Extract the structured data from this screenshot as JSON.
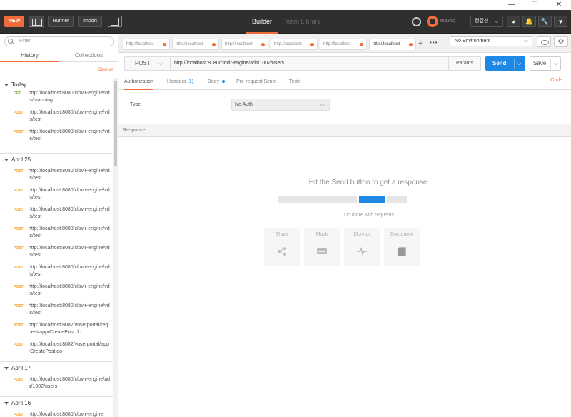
{
  "window": {
    "minimize": "—",
    "maximize": "☐",
    "close": "✕"
  },
  "header": {
    "new_label": "NEW",
    "runner_label": "Runner",
    "import_label": "Import",
    "modes": [
      "Builder",
      "Team Library"
    ],
    "sync_status": "IN SYNC",
    "user_name": "정길성"
  },
  "sidebar": {
    "search_placeholder": "Filter",
    "tabs": [
      "History",
      "Collections"
    ],
    "clear_all": "Clear all",
    "groups": [
      {
        "title": "Today",
        "items": [
          {
            "method": "GET",
            "url": "http://localhost:8080/clovir-engine/vdis/mapping"
          },
          {
            "method": "POST",
            "url": "http://localhost:8080/clovir-engine/vdis/test"
          },
          {
            "method": "POST",
            "url": "http://localhost:8080/clovir-engine/vdis/test"
          }
        ]
      },
      {
        "title": "April 25",
        "items": [
          {
            "method": "POST",
            "url": "http://localhost:8080/clovir-engine/vdis/test"
          },
          {
            "method": "POST",
            "url": "http://localhost:8080/clovir-engine/vdis/test"
          },
          {
            "method": "POST",
            "url": "http://localhost:8080/clovir-engine/vdis/test"
          },
          {
            "method": "POST",
            "url": "http://localhost:8080/clovir-engine/vdis/test"
          },
          {
            "method": "POST",
            "url": "http://localhost:8080/clovir-engine/vdis/test"
          },
          {
            "method": "POST",
            "url": "http://localhost:8080/clovir-engine/vdis/test"
          },
          {
            "method": "POST",
            "url": "http://localhost:8080/clovir-engine/vdis/test"
          },
          {
            "method": "POST",
            "url": "http://localhost:8080/clovir-engine/vdis/test"
          },
          {
            "method": "POST",
            "url": "http://localhost:8082/vuserportal/request/apprCreatePost.do"
          },
          {
            "method": "POST",
            "url": "http://localhost:8082/vuserportal/apprCreatePost.do"
          }
        ]
      },
      {
        "title": "April 17",
        "items": [
          {
            "method": "POST",
            "url": "http://localhost:8080/clovir-engine/ads/1002/users"
          }
        ]
      },
      {
        "title": "April 16",
        "items": [
          {
            "method": "POST",
            "url": "http://localhost:8080/clovir-engine"
          }
        ]
      }
    ]
  },
  "request_tabs": [
    {
      "label": "http://localhost"
    },
    {
      "label": "http://localhost"
    },
    {
      "label": "http://localhost"
    },
    {
      "label": "http://localhost"
    },
    {
      "label": "http://localhost"
    },
    {
      "label": "http://localhost"
    }
  ],
  "request_tab_add": "+",
  "request_tab_more": "•••",
  "environment": {
    "selected": "No Environment"
  },
  "request": {
    "method": "POST",
    "url": "http://localhost:8080/clovir-engine/ads/1002/users",
    "params_label": "Params",
    "send_label": "Send",
    "save_label": "Save"
  },
  "sub_tabs": {
    "authorization": "Authorization",
    "headers": "Headers",
    "headers_count": "(1)",
    "body": "Body",
    "pre_request": "Pre-request Script",
    "tests": "Tests",
    "code": "Code"
  },
  "auth": {
    "type_label": "Type",
    "type_value": "No Auth"
  },
  "response": {
    "label": "Response",
    "hint": "Hit the Send button to get a response.",
    "more": "Do more with requests",
    "cards": [
      "Share",
      "Mock",
      "Monitor",
      "Document"
    ]
  },
  "colors": {
    "accent": "#f26b3a",
    "send": "#1e88e5",
    "get": "#80b040",
    "post": "#f0a030"
  }
}
